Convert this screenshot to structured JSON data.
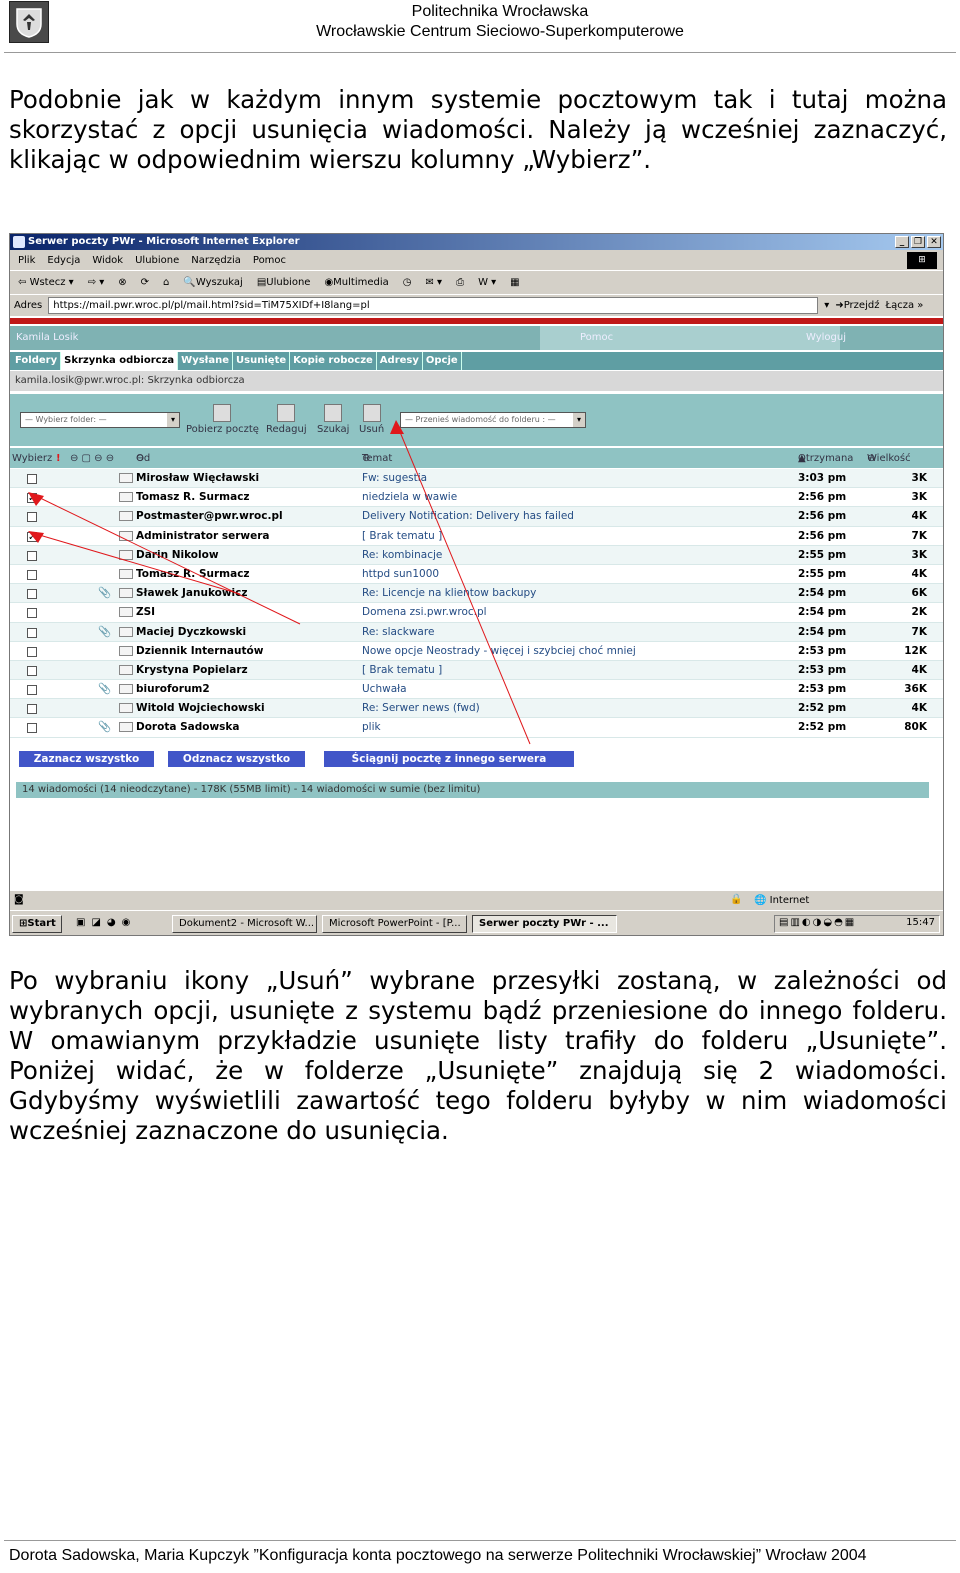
{
  "header": {
    "line1": "Politechnika Wrocławska",
    "line2": "Wrocławskie Centrum Sieciowo-Superkomputerowe"
  },
  "paragraph1": "Podobnie jak w każdym innym systemie pocztowym tak i tutaj można skorzystać z opcji usunięcia wiadomości. Należy ją wcześniej zaznaczyć, klikając w odpowiednim wierszu kolumny „Wybierz”.",
  "screenshot": {
    "window_title": "Serwer poczty PWr - Microsoft Internet Explorer",
    "menu": [
      "Plik",
      "Edycja",
      "Widok",
      "Ulubione",
      "Narzędzia",
      "Pomoc"
    ],
    "toolbar": [
      "Wstecz",
      "Wyszukaj",
      "Ulubione",
      "Multimedia"
    ],
    "address_label": "Adres",
    "address": "https://mail.pwr.wroc.pl/pl/mail.html?sid=TiM75XIDf+I8lang=pl",
    "go_label": "Przejdź",
    "links_label": "Łącza",
    "user_name": "Kamila Losik",
    "help": "Pomoc",
    "logout": "Wyloguj",
    "nav": [
      "Foldery",
      "Skrzynka odbiorcza",
      "Wysłane",
      "Usunięte",
      "Kopie robocze",
      "Adresy",
      "Opcje"
    ],
    "breadcrumb": "kamila.losik@pwr.wroc.pl: Skrzynka odbiorcza",
    "folder_select": "— Wybierz folder: —",
    "actions": [
      "Pobierz pocztę",
      "Redaguj",
      "Szukaj",
      "Usuń"
    ],
    "move_select": "— Przenieś wiadomość do folderu : —",
    "columns": {
      "select": "Wybierz",
      "from": "Od",
      "subject": "Temat",
      "received": "Otrzymana",
      "size": "Wielkość"
    },
    "messages": [
      {
        "from": "Mirosław Więcławski",
        "subject": "Fw: sugestia",
        "date": "3:03 pm",
        "size": "3K",
        "checked": false,
        "attach": false
      },
      {
        "from": "Tomasz R. Surmacz",
        "subject": "niedziela w wawie",
        "date": "2:56 pm",
        "size": "3K",
        "checked": true,
        "attach": false
      },
      {
        "from": "Postmaster@pwr.wroc.pl",
        "subject": "Delivery Notification: Delivery has failed",
        "date": "2:56 pm",
        "size": "4K",
        "checked": false,
        "attach": false
      },
      {
        "from": "Administrator serwera",
        "subject": "[ Brak tematu ]",
        "date": "2:56 pm",
        "size": "7K",
        "checked": true,
        "attach": false
      },
      {
        "from": "Darin Nikolow",
        "subject": "Re: kombinacje",
        "date": "2:55 pm",
        "size": "3K",
        "checked": false,
        "attach": false
      },
      {
        "from": "Tomasz R. Surmacz",
        "subject": "httpd sun1000",
        "date": "2:55 pm",
        "size": "4K",
        "checked": false,
        "attach": false
      },
      {
        "from": "Sławek Janukowicz",
        "subject": "Re: Licencje na klientow backupy",
        "date": "2:54 pm",
        "size": "6K",
        "checked": false,
        "attach": true
      },
      {
        "from": "ZSI",
        "subject": "Domena zsi.pwr.wroc.pl",
        "date": "2:54 pm",
        "size": "2K",
        "checked": false,
        "attach": false
      },
      {
        "from": "Maciej Dyczkowski",
        "subject": "Re: slackware",
        "date": "2:54 pm",
        "size": "7K",
        "checked": false,
        "attach": true
      },
      {
        "from": "Dziennik Internautów",
        "subject": "Nowe opcje Neostrady - więcej i szybciej choć mniej",
        "date": "2:53 pm",
        "size": "12K",
        "checked": false,
        "attach": false
      },
      {
        "from": "Krystyna Popielarz",
        "subject": "[ Brak tematu ]",
        "date": "2:53 pm",
        "size": "4K",
        "checked": false,
        "attach": false
      },
      {
        "from": "biuroforum2",
        "subject": "Uchwała",
        "date": "2:53 pm",
        "size": "36K",
        "checked": false,
        "attach": true
      },
      {
        "from": "Witold Wojciechowski",
        "subject": "Re: Serwer news (fwd)",
        "date": "2:52 pm",
        "size": "4K",
        "checked": false,
        "attach": false
      },
      {
        "from": "Dorota Sadowska",
        "subject": "plik",
        "date": "2:52 pm",
        "size": "80K",
        "checked": false,
        "attach": true
      }
    ],
    "buttons": {
      "select_all": "Zaznacz wszystko",
      "deselect_all": "Odznacz wszystko",
      "fetch_other": "Ściągnij pocztę z innego serwera"
    },
    "status": "14 wiadomości (14 nieodczytane) - 178K (55MB limit) - 14 wiadomości w sumie (bez limitu)",
    "ie_zone": "Internet",
    "taskbar": {
      "start": "Start",
      "tasks": [
        "Dokument2 - Microsoft W...",
        "Microsoft PowerPoint - [P...",
        "Serwer poczty PWr - ..."
      ],
      "clock": "15:47"
    },
    "colors": {
      "teal": "#8fc3c3",
      "nav": "#5f9ea3",
      "link": "#244c84",
      "button": "#4155c8",
      "arrow": "#e0181c"
    }
  },
  "paragraph2": "Po wybraniu ikony „Usuń” wybrane przesyłki zostaną, w zależności od wybranych opcji, usunięte z systemu bądź przeniesione do innego folderu. W omawianym przykładzie usunięte listy trafiły do folderu „Usunięte”. Poniżej widać, że w folderze „Usunięte” znajdują się 2 wiadomości. Gdybyśmy wyświetlili zawartość tego folderu byłyby w nim wiadomości wcześniej zaznaczone do usunięcia.",
  "footer": "Dorota Sadowska, Maria Kupczyk   ”Konfiguracja konta pocztowego na serwerze Politechniki Wrocławskiej”  Wrocław 2004"
}
